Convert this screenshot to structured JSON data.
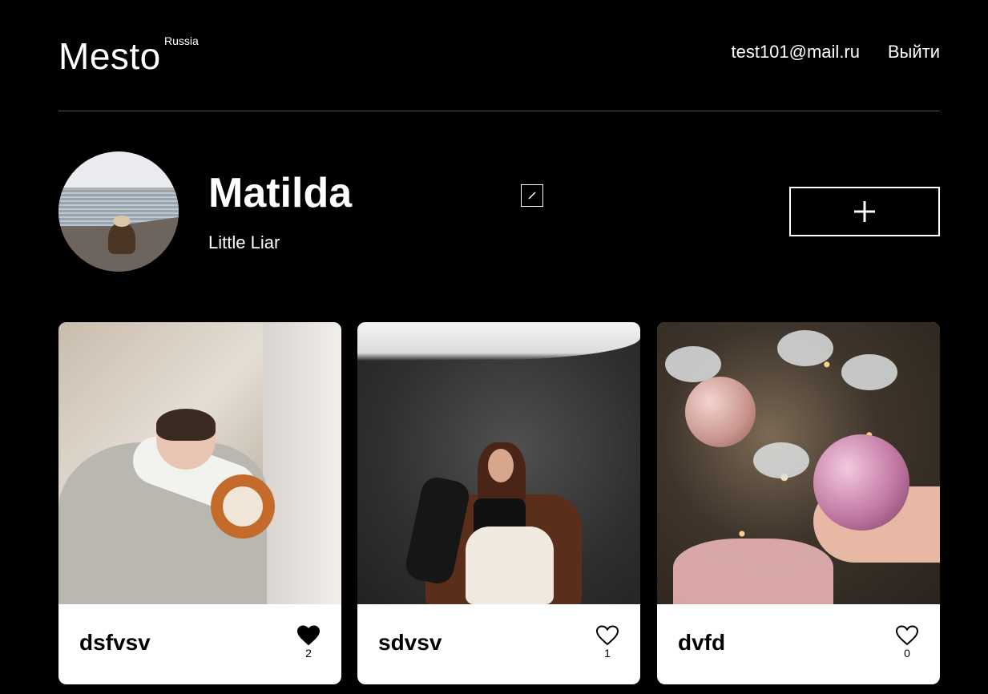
{
  "header": {
    "logo": "Mesto",
    "logo_sub": "Russia",
    "email": "test101@mail.ru",
    "logout_label": "Выйти"
  },
  "profile": {
    "name": "Matilda",
    "about": "Little Liar"
  },
  "cards": [
    {
      "title": "dsfvsv",
      "likes": "2",
      "liked": true
    },
    {
      "title": "sdvsv",
      "likes": "1",
      "liked": false
    },
    {
      "title": "dvfd",
      "likes": "0",
      "liked": false
    }
  ],
  "icons": {
    "edit": "pencil-icon",
    "add": "plus-icon",
    "like": "heart-icon"
  },
  "colors": {
    "background": "#000000",
    "card": "#ffffff",
    "divider": "#545454"
  }
}
